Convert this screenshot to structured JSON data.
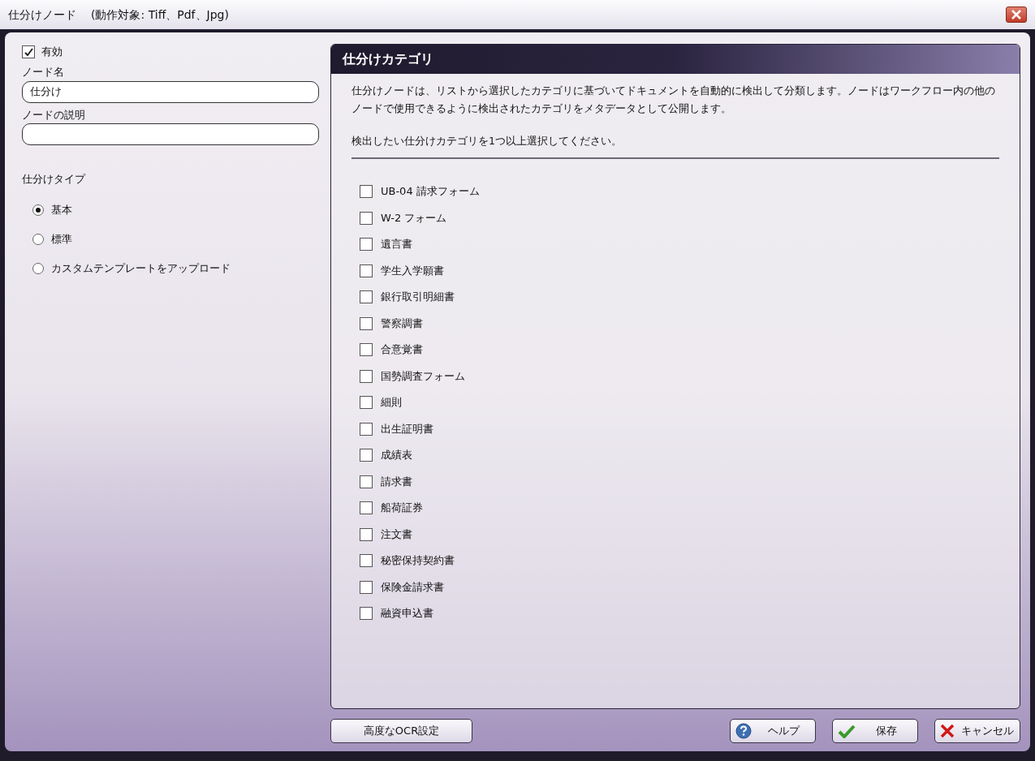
{
  "window": {
    "title": "仕分けノード",
    "subtitle": "(動作対象: Tiff、Pdf、Jpg)"
  },
  "enabled": {
    "label": "有効",
    "checked": true
  },
  "node_name": {
    "label": "ノード名",
    "value": "仕分け"
  },
  "node_description": {
    "label": "ノードの説明"
  },
  "sort_type": {
    "label": "仕分けタイプ",
    "options": [
      {
        "label": "基本",
        "selected": true
      },
      {
        "label": "標準",
        "selected": false
      },
      {
        "label": "カスタムテンプレートをアップロード",
        "selected": false
      }
    ]
  },
  "category_panel": {
    "title": "仕分けカテゴリ",
    "description": "仕分けノードは、リストから選択したカテゴリに基づいてドキュメントを自動的に検出して分類します。ノードはワークフロー内の他のノードで使用できるように検出されたカテゴリをメタデータとして公開します。",
    "instruction": "検出したい仕分けカテゴリを1つ以上選択してください。",
    "categories": [
      {
        "label": "UB-04 請求フォーム",
        "checked": false
      },
      {
        "label": "W-2 フォーム",
        "checked": false
      },
      {
        "label": "遺言書",
        "checked": false
      },
      {
        "label": "学生入学願書",
        "checked": false
      },
      {
        "label": "銀行取引明細書",
        "checked": false
      },
      {
        "label": "警察調書",
        "checked": false
      },
      {
        "label": "合意覚書",
        "checked": false
      },
      {
        "label": "国勢調査フォーム",
        "checked": false
      },
      {
        "label": "細則",
        "checked": false
      },
      {
        "label": "出生証明書",
        "checked": false
      },
      {
        "label": "成績表",
        "checked": false
      },
      {
        "label": "請求書",
        "checked": false
      },
      {
        "label": "船荷証券",
        "checked": false
      },
      {
        "label": "注文書",
        "checked": false
      },
      {
        "label": "秘密保持契約書",
        "checked": false
      },
      {
        "label": "保険金請求書",
        "checked": false
      },
      {
        "label": "融資申込書",
        "checked": false
      }
    ]
  },
  "buttons": [
    {
      "kind": "plain",
      "label": "高度なOCR設定"
    },
    {
      "kind": "help",
      "label": "ヘルプ"
    },
    {
      "kind": "save",
      "label": "保存"
    },
    {
      "kind": "cancel",
      "label": "キャンセル"
    }
  ]
}
